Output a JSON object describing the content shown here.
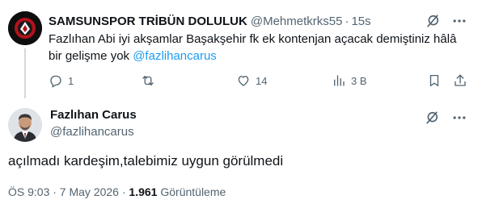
{
  "reply": {
    "author_name": "SAMSUNSPOR TRİBÜN DOLULUK",
    "author_handle": "@Mehmetkrks55",
    "separator": "·",
    "time": "15s",
    "text_before": "Fazlıhan Abi iyi akşamlar Başakşehir fk ek kontenjan açacak demiştiniz hâlâ bir gelişme yok ",
    "mention": "@fazlihancarus",
    "actions": {
      "reply_count": "1",
      "retweet_count": "",
      "like_count": "14",
      "views_count": "3 B"
    }
  },
  "main": {
    "author_name": "Fazlıhan Carus",
    "author_handle": "@fazlihancarus",
    "text": "açılmadı kardeşim,talebimiz uygun görülmedi",
    "timestamp": "ÖS 9:03 · 7 May 2026",
    "meta_separator": " · ",
    "views_count": "1.961",
    "views_label": "Görüntüleme"
  },
  "colors": {
    "text": "#0f1419",
    "secondary": "#536471",
    "link": "#1d9bf0",
    "thread_line": "#cfd9de"
  }
}
